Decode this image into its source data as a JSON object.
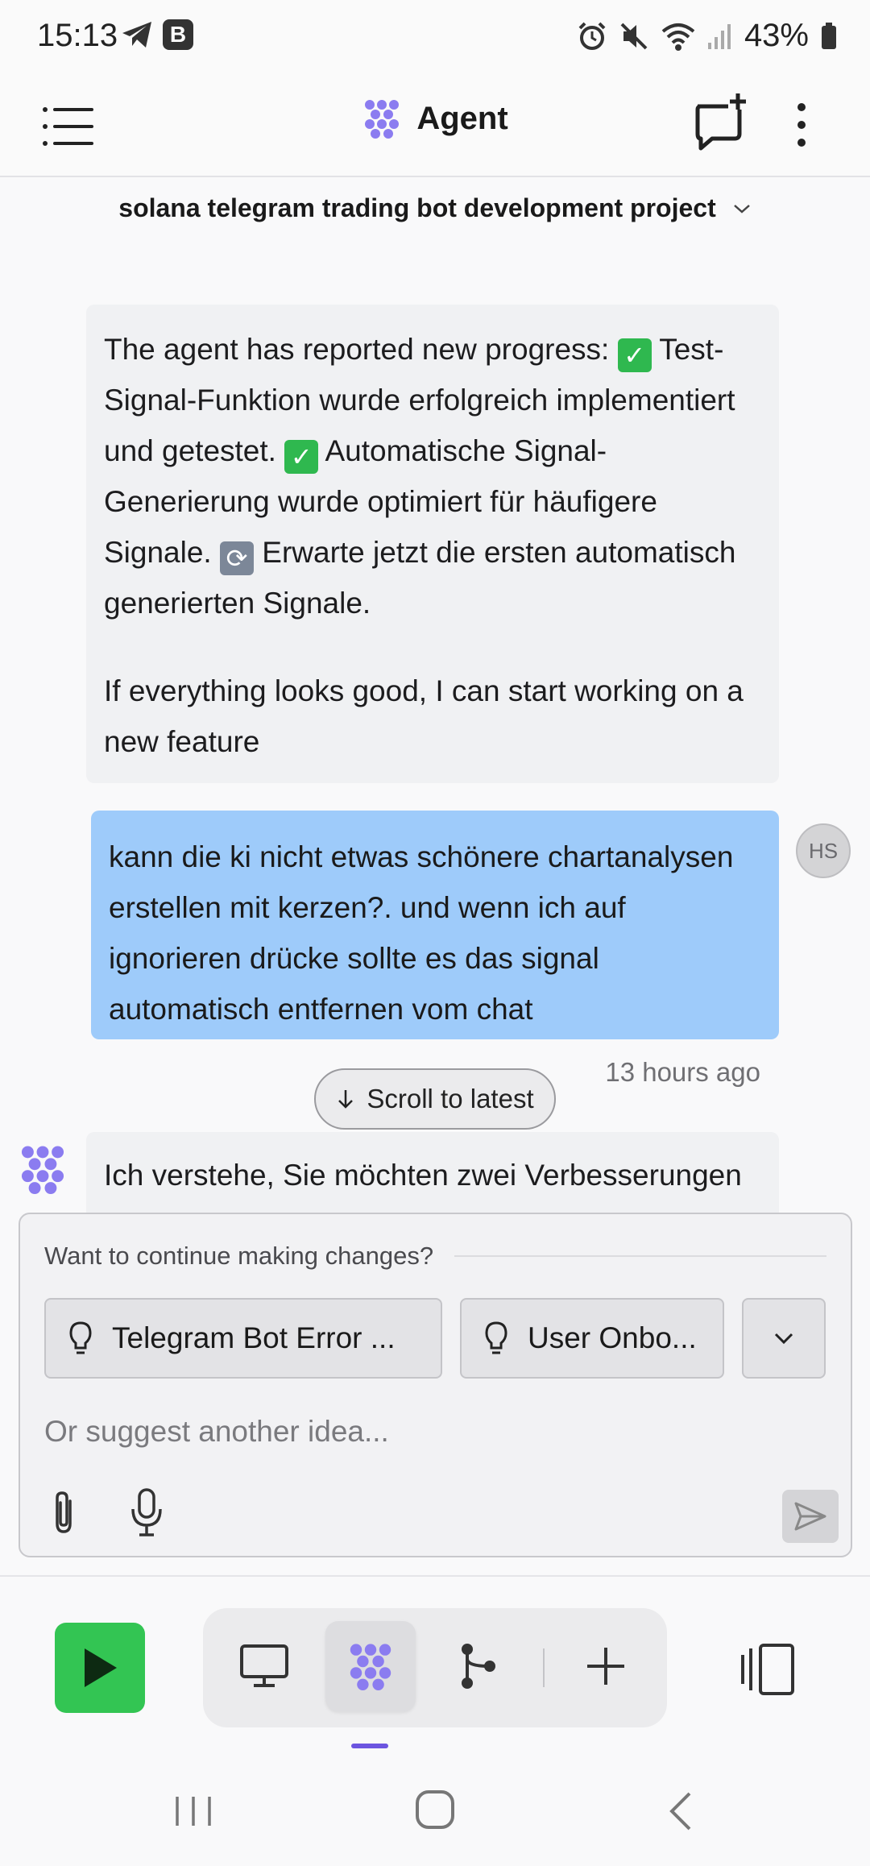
{
  "status_bar": {
    "time": "15:13",
    "telegram_icon": "telegram-plane-icon",
    "b_badge": "B",
    "battery": "43%"
  },
  "header": {
    "title": "Agent",
    "menu_icon": "list-menu-icon",
    "new_chat_icon": "new-chat-icon",
    "more_icon": "more-vertical-icon"
  },
  "project": {
    "name": "solana telegram trading bot development project"
  },
  "messages": {
    "agent_progress": {
      "line1_pre": "The agent has reported new progress: ",
      "line1_post": " Test-Signal-Funktion wurde erfolgreich implementiert und getestet. ",
      "line2_post": " Automatische Signal-Generierung wurde optimiert für häufigere Signale. ",
      "line3_post": " Erwarte jetzt die ersten automatisch generierten Signale.",
      "followup": "If everything looks good, I can start working on a new feature"
    },
    "user": {
      "text": "kann die ki nicht etwas schönere chartanalysen erstellen mit kerzen?. und wenn ich auf ignorieren drücke sollte es das signal automatisch entfernen vom chat",
      "avatar_initials": "HS",
      "timestamp": "13 hours ago"
    },
    "agent_reply": {
      "text": "Ich verstehe, Sie möchten zwei Verbesserungen"
    }
  },
  "scroll_latest": {
    "label": "Scroll to latest"
  },
  "composer": {
    "heading": "Want to continue making changes?",
    "suggestions": [
      "Telegram Bot Error ...",
      "User Onbo..."
    ],
    "input_placeholder": "Or suggest another idea..."
  },
  "colors": {
    "accent_purple": "#8b7cf0",
    "user_bubble": "#9ecbfa",
    "run_green": "#33c553"
  }
}
